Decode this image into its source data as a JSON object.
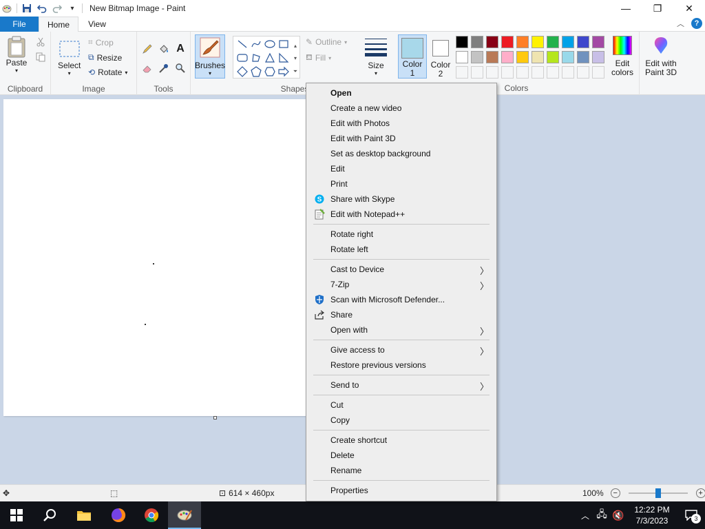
{
  "window": {
    "title": "New Bitmap Image - Paint",
    "controls": {
      "minimize": "—",
      "maximize": "❐",
      "close": "✕"
    }
  },
  "tabs": {
    "file": "File",
    "home": "Home",
    "view": "View",
    "help": "?"
  },
  "ribbon": {
    "clipboard": {
      "paste": "Paste",
      "group": "Clipboard"
    },
    "image": {
      "select": "Select",
      "crop": "Crop",
      "resize": "Resize",
      "rotate": "Rotate",
      "group": "Image"
    },
    "tools": {
      "group": "Tools"
    },
    "brushes": "Brushes",
    "shapes": {
      "outline": "Outline",
      "fill": "Fill",
      "group": "Shapes"
    },
    "size": "Size",
    "color1": "Color\n1",
    "color2": "Color\n2",
    "color1_value": "#a8d8ea",
    "color2_value": "#ffffff",
    "colors_group": "Colors",
    "edit_colors": "Edit\ncolors",
    "edit_paint3d": "Edit with\nPaint 3D",
    "palette_row1": [
      "#000000",
      "#7f7f7f",
      "#880015",
      "#ed1c24",
      "#ff7f27",
      "#fff200",
      "#22b14c",
      "#00a2e8",
      "#3f48cc",
      "#a349a4"
    ],
    "palette_row2": [
      "#ffffff",
      "#c3c3c3",
      "#b97a57",
      "#ffaec9",
      "#ffc90e",
      "#efe4b0",
      "#b5e61d",
      "#99d9ea",
      "#7092be",
      "#c8bfe7"
    ]
  },
  "status": {
    "canvas_size": "614 × 460px",
    "zoom": "100%",
    "zoom_level": 0.5
  },
  "context_menu": {
    "groups": [
      [
        {
          "label": "Open",
          "bold": true
        },
        {
          "label": "Create a new video"
        },
        {
          "label": "Edit with Photos"
        },
        {
          "label": "Edit with Paint 3D"
        },
        {
          "label": "Set as desktop background"
        },
        {
          "label": "Edit"
        },
        {
          "label": "Print"
        },
        {
          "label": "Share with Skype",
          "icon": "skype-icon"
        },
        {
          "label": "Edit with Notepad++",
          "icon": "notepad-plus-plus-icon"
        }
      ],
      [
        {
          "label": "Rotate right"
        },
        {
          "label": "Rotate left"
        }
      ],
      [
        {
          "label": "Cast to Device",
          "submenu": true
        },
        {
          "label": "7-Zip",
          "submenu": true
        },
        {
          "label": "Scan with Microsoft Defender...",
          "icon": "defender-icon"
        },
        {
          "label": "Share",
          "icon": "share-icon"
        },
        {
          "label": "Open with",
          "submenu": true
        }
      ],
      [
        {
          "label": "Give access to",
          "submenu": true
        },
        {
          "label": "Restore previous versions"
        }
      ],
      [
        {
          "label": "Send to",
          "submenu": true
        }
      ],
      [
        {
          "label": "Cut"
        },
        {
          "label": "Copy"
        }
      ],
      [
        {
          "label": "Create shortcut"
        },
        {
          "label": "Delete"
        },
        {
          "label": "Rename"
        }
      ],
      [
        {
          "label": "Properties"
        }
      ]
    ]
  },
  "taskbar": {
    "time": "12:22 PM",
    "date": "7/3/2023",
    "notification_count": "3",
    "apps": [
      "start-icon",
      "search-icon",
      "file-explorer-icon",
      "firefox-icon",
      "chrome-icon",
      "paint-icon"
    ]
  }
}
